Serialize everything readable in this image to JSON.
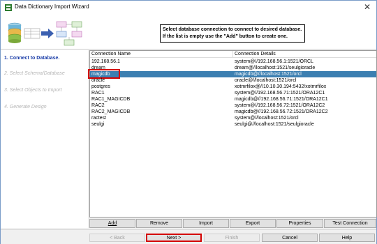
{
  "window": {
    "title": "Data Dictionary Import Wizard",
    "close_glyph": "✕"
  },
  "header": {
    "instruction_line1": "Select database connection to connect to desired database.",
    "instruction_line2": "If the list is empty use the \"Add\" button to create one."
  },
  "steps": [
    {
      "label": "1. Connect to Database.",
      "active": true
    },
    {
      "label": "2. Select Schema/Database",
      "active": false
    },
    {
      "label": "3. Select Objects to Import",
      "active": false
    },
    {
      "label": "4. Generate Design",
      "active": false
    }
  ],
  "list": {
    "columns": [
      "Connection Name",
      "Connection Details"
    ],
    "rows": [
      {
        "name": "192.168.56.1",
        "details": "system@//192.168.56.1:1521/ORCL"
      },
      {
        "name": "dream",
        "details": "dream@//localhost:1521/seulgioracle"
      },
      {
        "name": "magicdb",
        "details": "magicdb@//localhost:1521/orcl",
        "selected": true
      },
      {
        "name": "oracle",
        "details": "oracle@//localhost:1521/orcl"
      },
      {
        "name": "postgres",
        "details": "xotmrfilox@//10.10.30.194:5432/xotmrfilox"
      },
      {
        "name": "RAC1",
        "details": "system@//192.168.56.71:1521/ORA12C1"
      },
      {
        "name": "RAC1_MAGICDB",
        "details": "magicdb@//192.168.56.71:1521/ORA12C1"
      },
      {
        "name": "RAC2",
        "details": "system@//192.168.56.72:1521/ORA12C2"
      },
      {
        "name": "RAC2_MAGICDB",
        "details": "magicdb@//192.168.56.72:1521/ORA12C2"
      },
      {
        "name": "ractest",
        "details": "system@//localhost:1521/orcl"
      },
      {
        "name": "seulgi",
        "details": "seulgi@//localhost:1521/seulgioracle"
      }
    ]
  },
  "panel_buttons": [
    {
      "key": "add",
      "label": "Add",
      "underline": "A"
    },
    {
      "key": "remove",
      "label": "Remove",
      "underline": "R"
    },
    {
      "key": "import",
      "label": "Import",
      "underline": "I"
    },
    {
      "key": "export",
      "label": "Export",
      "underline": "E"
    },
    {
      "key": "properties",
      "label": "Properties",
      "underline": "P"
    },
    {
      "key": "test_connection",
      "label": "Test Connection",
      "underline": "T"
    }
  ],
  "nav_buttons": {
    "back": "< Back",
    "next": "Next >",
    "finish": "Finish",
    "cancel": "Cancel",
    "help": "Help"
  },
  "colors": {
    "selection": "#3c7fb1",
    "active_step": "#1a3da8",
    "annotation_red": "#d40000"
  }
}
